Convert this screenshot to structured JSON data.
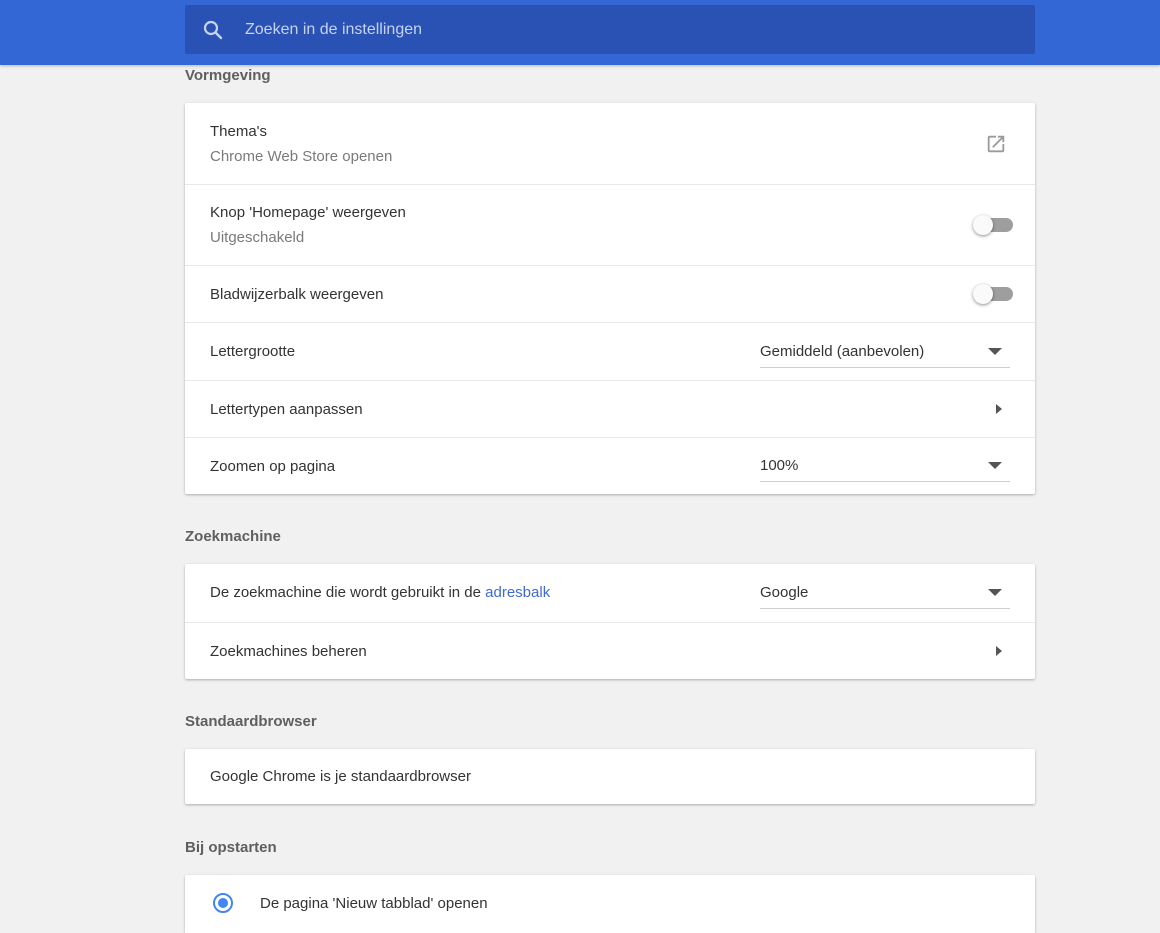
{
  "search": {
    "placeholder": "Zoeken in de instellingen",
    "icon": "search-icon"
  },
  "appearance": {
    "title": "Vormgeving",
    "themes": {
      "label": "Thema's",
      "sub": "Chrome Web Store openen",
      "icon": "open-in-new-icon"
    },
    "home_button": {
      "label": "Knop 'Homepage' weergeven",
      "sub": "Uitgeschakeld",
      "enabled": false
    },
    "bookmarks_bar": {
      "label": "Bladwijzerbalk weergeven",
      "enabled": false
    },
    "font_size": {
      "label": "Lettergrootte",
      "value": "Gemiddeld (aanbevolen)"
    },
    "customize_fonts": {
      "label": "Lettertypen aanpassen"
    },
    "page_zoom": {
      "label": "Zoomen op pagina",
      "value": "100%"
    }
  },
  "search_engine": {
    "title": "Zoekmachine",
    "engine": {
      "label_prefix": "De zoekmachine die wordt gebruikt in de ",
      "label_link": "adresbalk",
      "value": "Google"
    },
    "manage": {
      "label": "Zoekmachines beheren"
    }
  },
  "default_browser": {
    "title": "Standaardbrowser",
    "status": "Google Chrome is je standaardbrowser"
  },
  "on_startup": {
    "title": "Bij opstarten",
    "option_new_tab": {
      "label": "De pagina 'Nieuw tabblad' openen",
      "selected": true
    }
  },
  "colors": {
    "header": "#3367d6",
    "search_box": "#2a52b5",
    "accent": "#4285f4",
    "link": "#3f6bd0"
  }
}
